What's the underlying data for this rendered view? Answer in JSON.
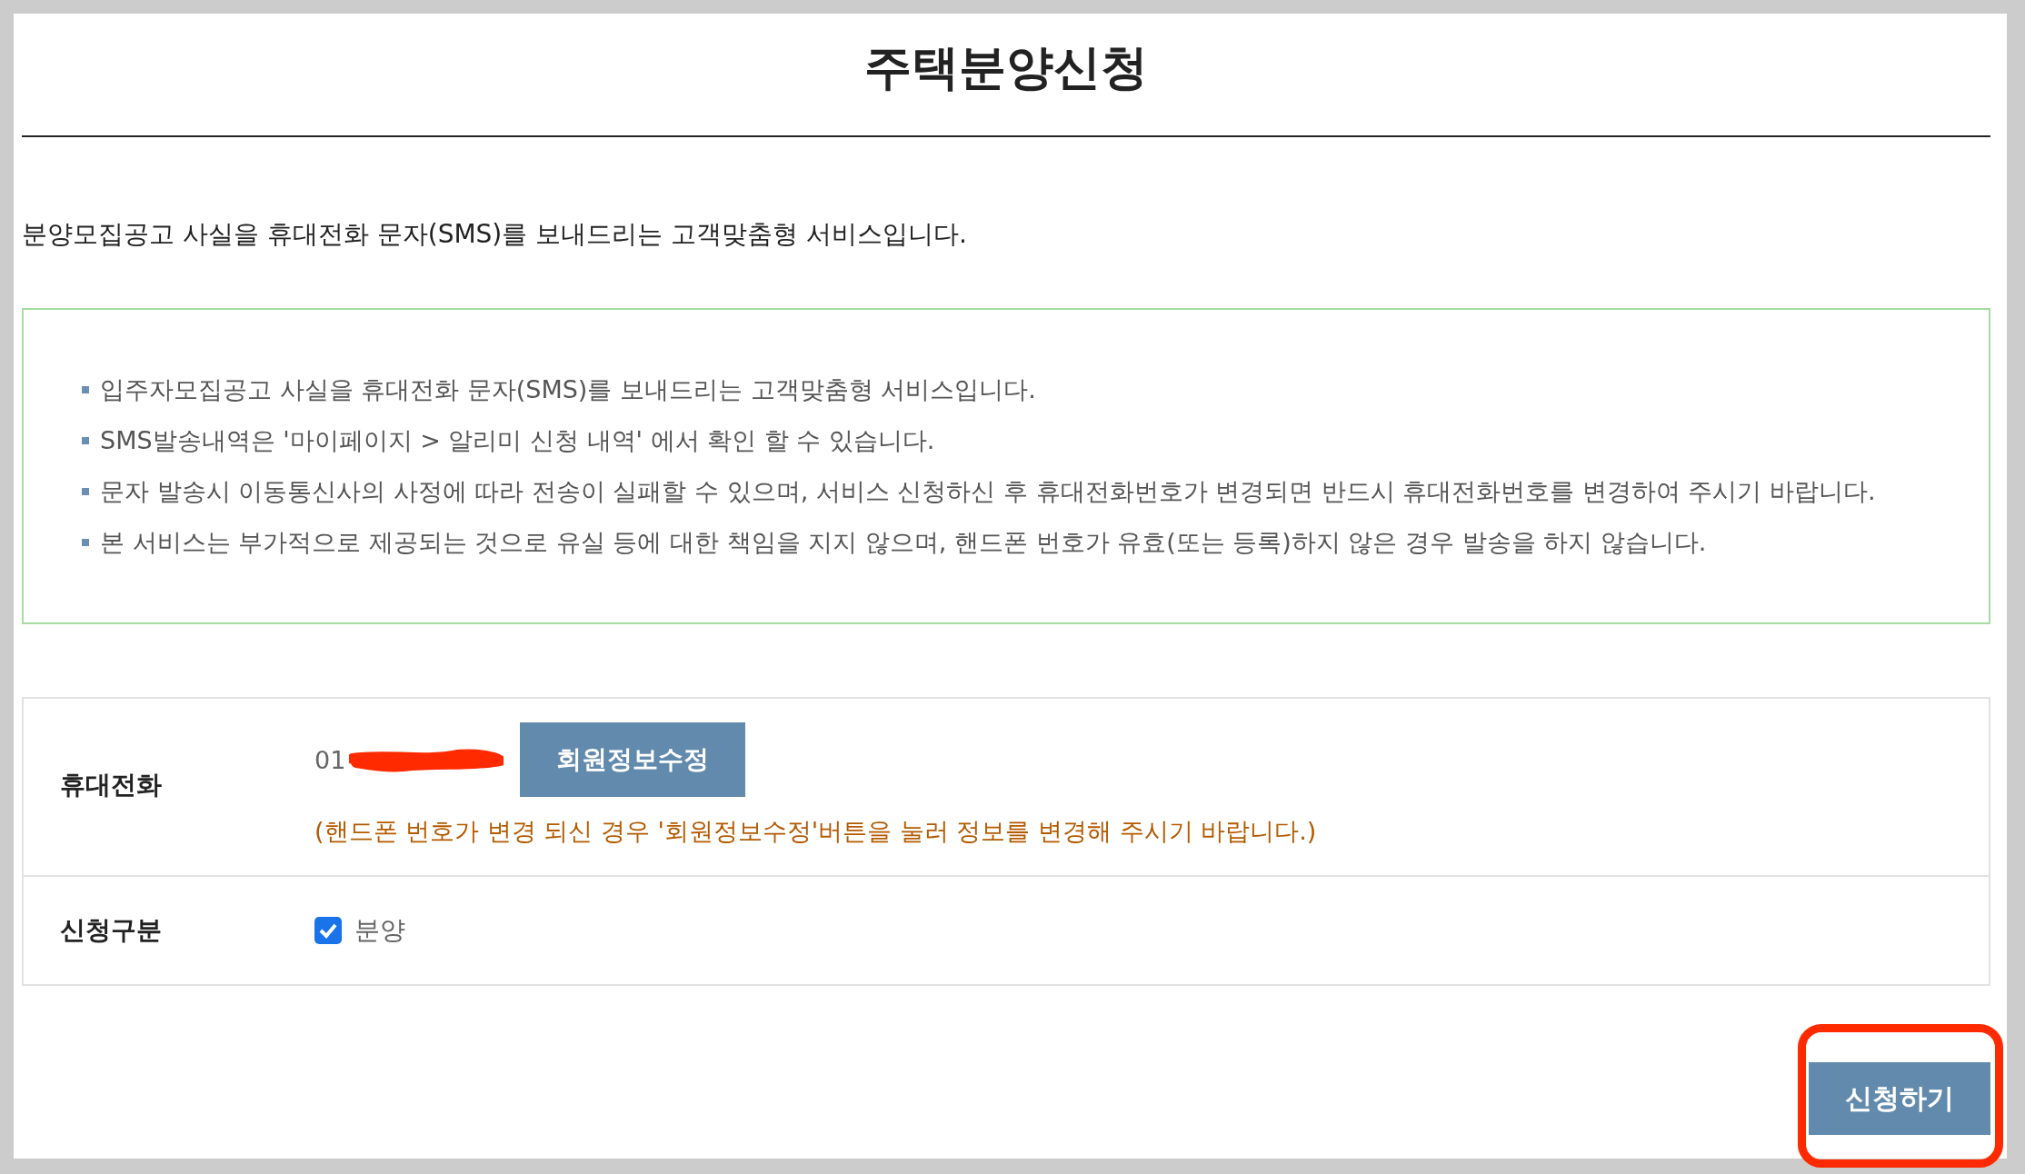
{
  "title": "주택분양신청",
  "intro": "분양모집공고 사실을 휴대전화 문자(SMS)를 보내드리는 고객맞춤형 서비스입니다.",
  "notices": [
    "입주자모집공고 사실을 휴대전화 문자(SMS)를 보내드리는 고객맞춤형 서비스입니다.",
    "SMS발송내역은 '마이페이지 > 알리미 신청 내역' 에서 확인 할 수 있습니다.",
    "문자 발송시 이동통신사의 사정에 따라 전송이 실패할 수 있으며, 서비스 신청하신 후 휴대전화번호가 변경되면 반드시 휴대전화번호를 변경하여 주시기 바랍니다.",
    "본 서비스는 부가적으로 제공되는 것으로 유실 등에 대한 책임을 지지 않으며, 핸드폰 번호가 유효(또는 등록)하지 않은 경우 발송을 하지 않습니다."
  ],
  "phone": {
    "label": "휴대전화",
    "value": "01",
    "edit_button": "회원정보수정",
    "note": "(핸드폰 번호가 변경 되신 경우 '회원정보수정'버튼을 눌러 정보를 변경해 주시기 바랍니다.)"
  },
  "category": {
    "label": "신청구분",
    "option": "분양",
    "checked": true
  },
  "submit": "신청하기"
}
